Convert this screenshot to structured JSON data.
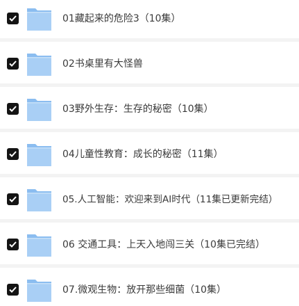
{
  "items": [
    {
      "label": "01藏起来的危险3（10集）",
      "checked": true
    },
    {
      "label": "02书桌里有大怪兽",
      "checked": true
    },
    {
      "label": "03野外生存：生存的秘密（10集）",
      "checked": true
    },
    {
      "label": "04儿童性教育：成长的秘密（11集）",
      "checked": true
    },
    {
      "label": "05.人工智能：欢迎来到AI时代（11集已更新完结）",
      "checked": true
    },
    {
      "label": "06 交通工具：上天入地闯三关（10集已完结）",
      "checked": true
    },
    {
      "label": "07.微观生物：放开那些细菌（10集）",
      "checked": true
    }
  ],
  "colors": {
    "checkbox": "#141414",
    "folder_front": "#a9cff5",
    "folder_back": "#8bbdf0",
    "text": "#3a3a3a",
    "divider": "#f3f3f3"
  }
}
